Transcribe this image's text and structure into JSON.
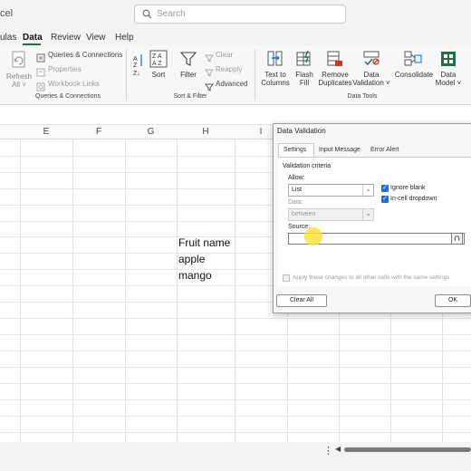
{
  "titlebar": {
    "app_title": "cel",
    "search_placeholder": "Search"
  },
  "menu": {
    "tabs": [
      {
        "label": "ulas"
      },
      {
        "label": "Data"
      },
      {
        "label": "Review"
      },
      {
        "label": "View"
      },
      {
        "label": "Help"
      }
    ],
    "active": "Data"
  },
  "ribbon": {
    "refresh_label": "Refresh",
    "all_label": "All ˅",
    "queries_connections": "Queries & Connections",
    "properties": "Properties",
    "workbook_links": "Workbook Links",
    "group_queries": "Queries & Connections",
    "sort_label": "Sort",
    "filter_label": "Filter",
    "clear_label": "Clear",
    "reapply_label": "Reapply",
    "advanced_label": "Advanced",
    "group_sort_filter": "Sort & Filter",
    "text_to_columns_1": "Text to",
    "text_to_columns_2": "Columns",
    "flash_fill_1": "Flash",
    "flash_fill_2": "Fill",
    "remove_duplicates_1": "Remove",
    "remove_duplicates_2": "Duplicates",
    "data_validation_1": "Data",
    "data_validation_2": "Validation ˅",
    "consolidate_label": "Consolidate",
    "data_model_1": "Data",
    "data_model_2": "Model ˅",
    "group_data_tools": "Data Tools"
  },
  "grid": {
    "columns": [
      "E",
      "F",
      "G",
      "H",
      "I"
    ],
    "cells": {
      "h1": "Fruit name",
      "h2": "apple",
      "h3": "mango"
    }
  },
  "dialog": {
    "title": "Data Validation",
    "tabs": {
      "settings": "Settings",
      "input_message": "Input Message",
      "error_alert": "Error Alert"
    },
    "section_label": "Validation criteria",
    "allow_label": "Allow:",
    "allow_value": "List",
    "data_label": "Data:",
    "data_value": "between",
    "ignore_blank": "Ignore blank",
    "incell_dropdown": "In-cell dropdown",
    "ignore_blank_checked": true,
    "incell_dropdown_checked": true,
    "source_label": "Source:",
    "source_value": "",
    "apply_all": "Apply these changes to all other cells with the same settings",
    "clear_all": "Clear All",
    "ok": "OK"
  }
}
